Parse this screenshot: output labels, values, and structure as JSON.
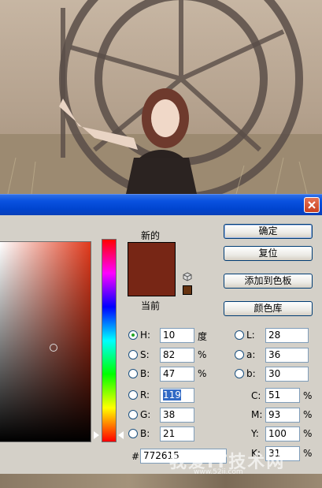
{
  "colors": {
    "current": "#772615",
    "new": "#772615",
    "websafe": "#663311",
    "titlebar": "#0a52e0"
  },
  "labels": {
    "new": "新的",
    "current": "当前"
  },
  "buttons": {
    "ok": "确定",
    "reset": "复位",
    "add_swatch": "添加到色板",
    "libraries": "颜色库"
  },
  "hsb": [
    {
      "label": "H:",
      "value": "10",
      "unit": "度"
    },
    {
      "label": "S:",
      "value": "82",
      "unit": "%"
    },
    {
      "label": "B:",
      "value": "47",
      "unit": "%"
    }
  ],
  "rgb": [
    {
      "label": "R:",
      "value": "119"
    },
    {
      "label": "G:",
      "value": "38"
    },
    {
      "label": "B:",
      "value": "21"
    }
  ],
  "lab": [
    {
      "label": "L:",
      "value": "28"
    },
    {
      "label": "a:",
      "value": "36"
    },
    {
      "label": "b:",
      "value": "30"
    }
  ],
  "cmyk": [
    {
      "label": "C:",
      "value": "51",
      "unit": "%"
    },
    {
      "label": "M:",
      "value": "93",
      "unit": "%"
    },
    {
      "label": "Y:",
      "value": "100",
      "unit": "%"
    },
    {
      "label": "K:",
      "value": "31",
      "unit": "%"
    }
  ],
  "hex": {
    "label": "#",
    "value": "772615"
  },
  "watermark": {
    "main": "我爱IT技术网",
    "sub": "www.52ij.com"
  }
}
